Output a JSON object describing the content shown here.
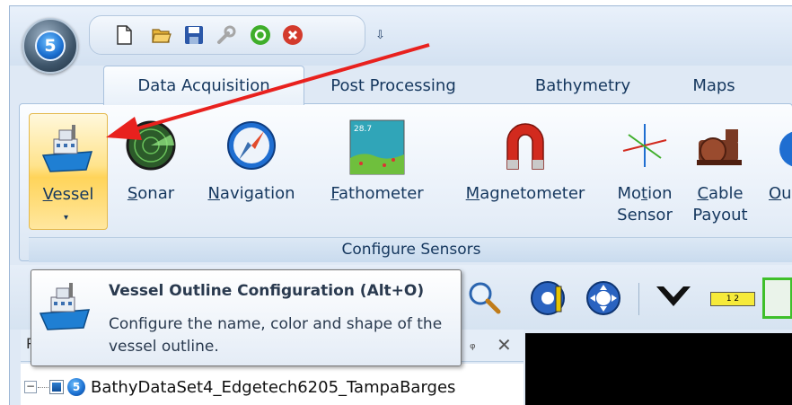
{
  "app": {
    "orb_glyph": "5",
    "quick_access": {
      "icons": [
        "new-document-icon",
        "open-folder-icon",
        "save-icon",
        "wrench-icon",
        "start-icon",
        "stop-icon"
      ],
      "more_glyph": "⇩"
    }
  },
  "tabs": [
    {
      "label": "Data Acquisition",
      "active": true
    },
    {
      "label": "Post Processing",
      "active": false
    },
    {
      "label": "Bathymetry",
      "active": false
    },
    {
      "label": "Maps",
      "active": false
    }
  ],
  "ribbon": {
    "group_caption": "Configure Sensors",
    "buttons": {
      "vessel": {
        "mnemonic": "V",
        "rest": "essel",
        "dropdown": "▾"
      },
      "sonar": {
        "mnemonic": "S",
        "rest": "onar"
      },
      "navigation": {
        "mnemonic": "N",
        "rest": "avigation"
      },
      "fathometer": {
        "mnemonic": "F",
        "rest": "athometer",
        "icon_text": "28.7"
      },
      "magnetometer": {
        "mnemonic": "M",
        "rest": "agnetometer"
      },
      "motion_sensor": {
        "line1_pre": "Mo",
        "line1_mnemonic": "t",
        "line1_post": "ion",
        "line2": "Sensor"
      },
      "cable_payout": {
        "line1_mnemonic": "C",
        "line1_post": "able",
        "line2": "Payout"
      },
      "partial": {
        "mnemonic": "O",
        "rest": "u"
      }
    }
  },
  "tooltip": {
    "title": "Vessel Outline Configuration (Alt+O)",
    "description": "Configure the name, color and shape of the vessel outline."
  },
  "toolbar2": {
    "ruler_text": "1    2"
  },
  "panel": {
    "header_letter": "P",
    "pin_glyph": "ᵩ",
    "close_glyph": "✕",
    "tree_item": "BathyDataSet4_Edgetech6205_TampaBarges",
    "expander_glyph": "−",
    "logo_glyph": "5"
  },
  "colors": {
    "annotation_arrow": "#e8211e",
    "accent_blue": "#15375e",
    "selected_button": "#ffd45a"
  }
}
